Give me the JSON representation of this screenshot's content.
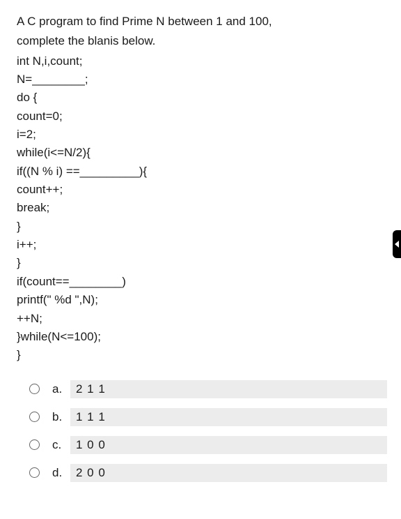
{
  "question": {
    "line1": "A C program to find Prime N between 1 and 100,",
    "line2": "complete the blanis below."
  },
  "code": {
    "l1": "int N,i,count;",
    "l2": "N=________;",
    "l3": "do {",
    "l4": "count=0;",
    "l5": "i=2;",
    "l6": "while(i<=N/2){",
    "l7": "if((N % i) ==_________){",
    "l8": "count++;",
    "l9": "break;",
    "l10": "}",
    "l11": "i++;",
    "l12": "}",
    "l13": "if(count==________)",
    "l14": "printf(\" %d \",N);",
    "l15": "++N;",
    "l16": "}while(N<=100);",
    "l17": "}"
  },
  "options": {
    "a": {
      "letter": "a.",
      "text": "2 1 1"
    },
    "b": {
      "letter": "b.",
      "text": "1 1 1"
    },
    "c": {
      "letter": "c.",
      "text": "1 0 0"
    },
    "d": {
      "letter": "d.",
      "text": "2 0 0"
    }
  }
}
